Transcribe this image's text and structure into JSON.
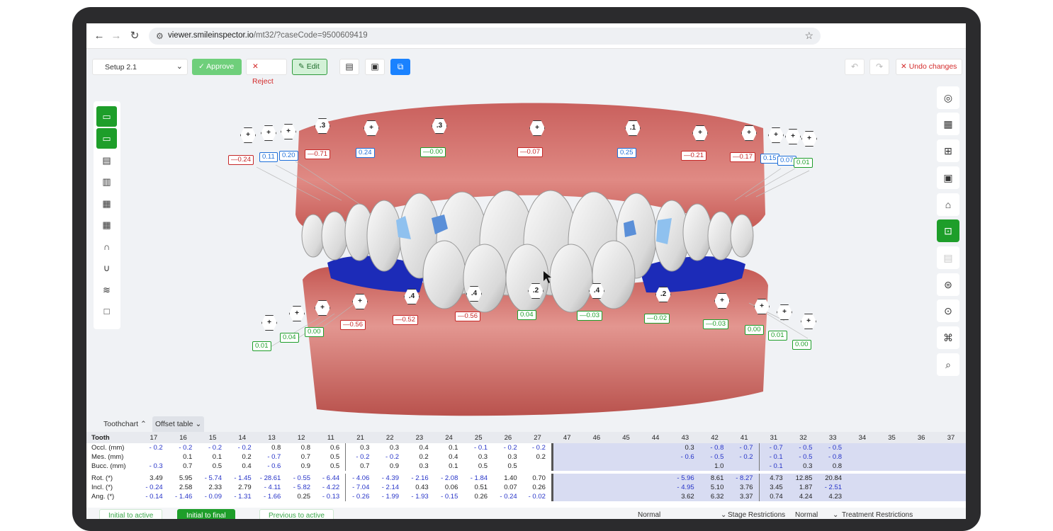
{
  "browser": {
    "url_host": "viewer.smileinspector.io",
    "url_path": "/mt32/?caseCode=9500609419"
  },
  "toolbar": {
    "setup_value": "Setup 2.1",
    "approve_label": "Approve",
    "reject_label": "Reject",
    "edit_label": "Edit",
    "undo_changes_label": "Undo changes"
  },
  "labels_upper": [
    {
      "hex": "+",
      "val": "—0.24",
      "type": "red"
    },
    {
      "hex": "+",
      "val": "0.11",
      "type": "blue"
    },
    {
      "hex": "+",
      "val": "0.20",
      "type": "blue"
    },
    {
      "hex": ".3",
      "val": "—0.71",
      "type": "red"
    },
    {
      "hex": "+",
      "val": "0.24",
      "type": "blue"
    },
    {
      "hex": ".3",
      "val": "—0.00",
      "type": "green"
    },
    {
      "hex": "+",
      "val": "—0.07",
      "type": "red"
    },
    {
      "hex": ".1",
      "val": "0.25",
      "type": "blue"
    },
    {
      "hex": "+",
      "val": "—0.21",
      "type": "red"
    },
    {
      "hex": "+",
      "val": "—0.17",
      "type": "red"
    },
    {
      "hex": "+",
      "val": "0.15",
      "type": "blue"
    },
    {
      "hex": "+",
      "val": "0.07",
      "type": "blue"
    },
    {
      "hex": "+",
      "val": "0.01",
      "type": "green"
    }
  ],
  "labels_lower": [
    {
      "hex": "+",
      "val": "0.01",
      "type": "green"
    },
    {
      "hex": "+",
      "val": "0.04",
      "type": "green"
    },
    {
      "hex": "+",
      "val": "0.00",
      "type": "green"
    },
    {
      "hex": "+",
      "val": "—0.56",
      "type": "red"
    },
    {
      "hex": ".4",
      "val": "—0.52",
      "type": "red"
    },
    {
      "hex": ".4",
      "val": "—0.56",
      "type": "red"
    },
    {
      "hex": ".2",
      "val": "0.04",
      "type": "green"
    },
    {
      "hex": ".4",
      "val": "—0.03",
      "type": "green"
    },
    {
      "hex": ".2",
      "val": "—0.02",
      "type": "green"
    },
    {
      "hex": "+",
      "val": "—0.03",
      "type": "green"
    },
    {
      "hex": "+",
      "val": "0.00",
      "type": "green"
    },
    {
      "hex": "+",
      "val": "0.01",
      "type": "green"
    },
    {
      "hex": "+",
      "val": "0.00",
      "type": "green"
    }
  ],
  "tabs": {
    "toothchart": "Toothchart",
    "offset_table": "Offset table"
  },
  "table": {
    "header_label": "Tooth",
    "teeth": [
      "17",
      "16",
      "15",
      "14",
      "13",
      "12",
      "11",
      "21",
      "22",
      "23",
      "24",
      "25",
      "26",
      "27",
      "47",
      "46",
      "45",
      "44",
      "43",
      "42",
      "41",
      "31",
      "32",
      "33",
      "34",
      "35",
      "36",
      "37"
    ],
    "rows": [
      {
        "label": "Occl. (mm)",
        "values": [
          "- 0.2",
          "- 0.2",
          "- 0.2",
          "- 0.2",
          "0.8",
          "0.8",
          "0.6",
          "0.3",
          "0.3",
          "0.4",
          "0.1",
          "- 0.1",
          "- 0.2",
          "- 0.2",
          "",
          "",
          "",
          "",
          "0.3",
          "- 0.8",
          "- 0.7",
          "- 0.7",
          "- 0.5",
          "- 0.5",
          "",
          "",
          "",
          ""
        ]
      },
      {
        "label": "Mes. (mm)",
        "values": [
          "",
          "0.1",
          "0.1",
          "0.2",
          "- 0.7",
          "0.7",
          "0.5",
          "- 0.2",
          "- 0.2",
          "0.2",
          "0.4",
          "0.3",
          "0.3",
          "0.2",
          "",
          "",
          "",
          "",
          "- 0.6",
          "- 0.5",
          "- 0.2",
          "- 0.1",
          "- 0.5",
          "- 0.8",
          "",
          "",
          "",
          ""
        ]
      },
      {
        "label": "Bucc. (mm)",
        "values": [
          "- 0.3",
          "0.7",
          "0.5",
          "0.4",
          "- 0.6",
          "0.9",
          "0.5",
          "0.7",
          "0.9",
          "0.3",
          "0.1",
          "0.5",
          "0.5",
          "",
          "",
          "",
          "",
          "",
          "",
          "1.0",
          "",
          "- 0.1",
          "0.3",
          "0.8",
          "",
          "",
          "",
          ""
        ]
      },
      {
        "label": "Rot. (*)",
        "values": [
          "3.49",
          "5.95",
          "- 5.74",
          "- 1.45",
          "- 28.61",
          "- 0.55",
          "- 6.44",
          "- 4.06",
          "- 4.39",
          "- 2.16",
          "- 2.08",
          "- 1.84",
          "1.40",
          "0.70",
          "",
          "",
          "",
          "",
          "- 5.96",
          "8.61",
          "- 8.27",
          "4.73",
          "12.85",
          "20.84",
          "",
          "",
          "",
          ""
        ]
      },
      {
        "label": "Incl. (*)",
        "values": [
          "- 0.24",
          "2.58",
          "2.33",
          "2.79",
          "- 4.11",
          "- 5.82",
          "- 4.22",
          "- 7.04",
          "- 2.14",
          "0.43",
          "0.06",
          "0.51",
          "0.07",
          "0.26",
          "",
          "",
          "",
          "",
          "- 4.95",
          "5.10",
          "3.76",
          "3.45",
          "1.87",
          "- 2.51",
          "",
          "",
          "",
          ""
        ]
      },
      {
        "label": "Ang. (*)",
        "values": [
          "- 0.14",
          "- 1.46",
          "- 0.09",
          "- 1.31",
          "- 1.66",
          "0.25",
          "- 0.13",
          "- 0.26",
          "- 1.99",
          "- 1.93",
          "- 0.15",
          "0.26",
          "- 0.24",
          "- 0.02",
          "",
          "",
          "",
          "",
          "3.62",
          "6.32",
          "3.37",
          "0.74",
          "4.24",
          "4.23",
          "",
          "",
          "",
          ""
        ]
      }
    ]
  },
  "footer": {
    "tab1": "Initial to active",
    "tab2": "Initial to final",
    "tab3": "Previous to active",
    "select1": "Normal",
    "select1_label": "Stage Restrictions",
    "select2": "Normal",
    "select2_label": "Treatment Restrictions"
  },
  "colors": {
    "green": "#1e9e2a",
    "red": "#c62828",
    "blue": "#1e6fd9",
    "gum": "#d7726d",
    "attachment_blue": "#1c2bb8"
  }
}
